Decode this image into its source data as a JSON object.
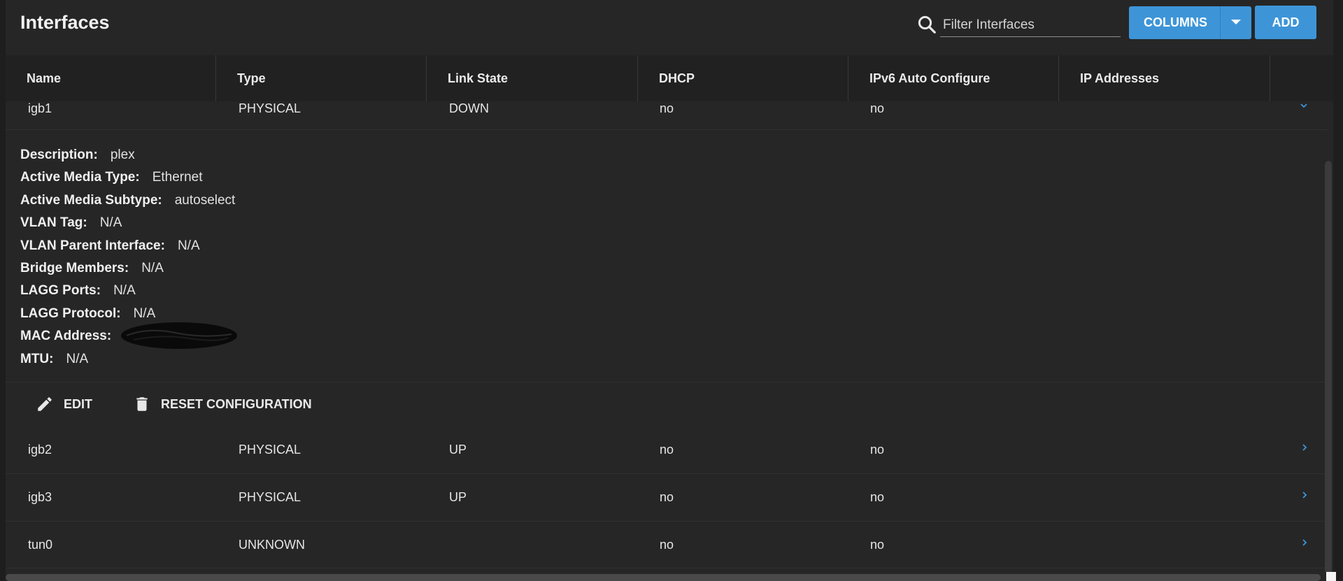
{
  "page": {
    "title": "Interfaces"
  },
  "search": {
    "placeholder": "Filter Interfaces",
    "value": ""
  },
  "toolbar": {
    "columns_label": "COLUMNS",
    "add_label": "ADD"
  },
  "columns": [
    "Name",
    "Type",
    "Link State",
    "DHCP",
    "IPv6 Auto Configure",
    "IP Addresses"
  ],
  "expanded_row": {
    "name": "igb1",
    "type": "PHYSICAL",
    "link_state": "DOWN",
    "dhcp": "no",
    "ipv6": "no",
    "ip_addresses": ""
  },
  "details": [
    {
      "label": "Description:",
      "value": "plex"
    },
    {
      "label": "Active Media Type:",
      "value": "Ethernet"
    },
    {
      "label": "Active Media Subtype:",
      "value": "autoselect"
    },
    {
      "label": "VLAN Tag:",
      "value": "N/A"
    },
    {
      "label": "VLAN Parent Interface:",
      "value": "N/A"
    },
    {
      "label": "Bridge Members:",
      "value": "N/A"
    },
    {
      "label": "LAGG Ports:",
      "value": "N/A"
    },
    {
      "label": "LAGG Protocol:",
      "value": "N/A"
    },
    {
      "label": "MAC Address:",
      "value": ""
    },
    {
      "label": "MTU:",
      "value": "N/A"
    }
  ],
  "actions": {
    "edit_label": "EDIT",
    "reset_label": "RESET CONFIGURATION"
  },
  "rows": [
    {
      "name": "igb2",
      "type": "PHYSICAL",
      "link_state": "UP",
      "dhcp": "no",
      "ipv6": "no",
      "ip_addresses": ""
    },
    {
      "name": "igb3",
      "type": "PHYSICAL",
      "link_state": "UP",
      "dhcp": "no",
      "ipv6": "no",
      "ip_addresses": ""
    },
    {
      "name": "tun0",
      "type": "UNKNOWN",
      "link_state": "",
      "dhcp": "no",
      "ipv6": "no",
      "ip_addresses": ""
    }
  ],
  "colors": {
    "accent": "#3d95d8",
    "background": "#262626",
    "header_bg": "#212121"
  },
  "icons": {
    "search": "search-icon",
    "edit": "pencil-icon",
    "reset": "trash-icon",
    "row_toggle": "chevron-icon"
  }
}
